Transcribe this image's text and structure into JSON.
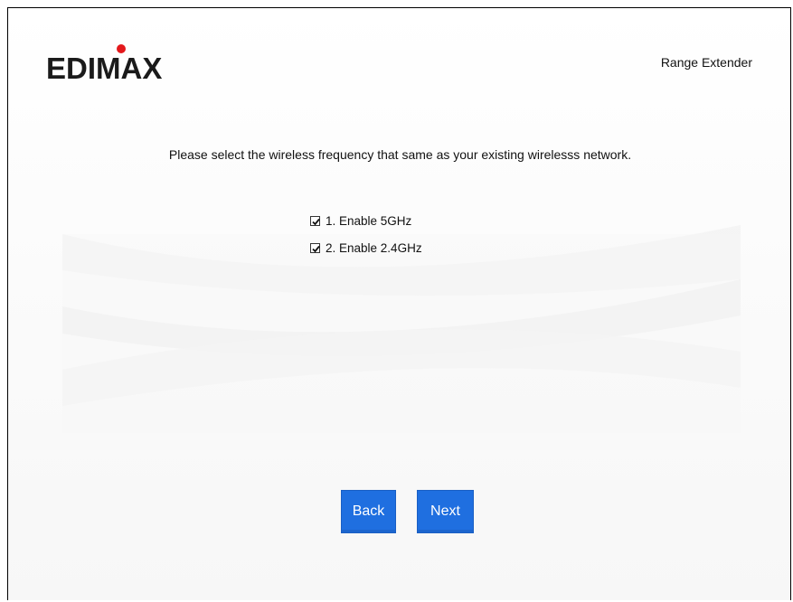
{
  "header": {
    "logo_text": "EDIMAX",
    "product_name": "Range Extender"
  },
  "main": {
    "instruction": "Please select the wireless frequency that same as your existing wirelesss network.",
    "options": [
      {
        "label": "1. Enable 5GHz",
        "checked": true
      },
      {
        "label": "2. Enable 2.4GHz",
        "checked": true
      }
    ]
  },
  "buttons": {
    "back_label": "Back",
    "next_label": "Next"
  },
  "colors": {
    "button_bg": "#1f6fe0",
    "logo_dot": "#e3181b",
    "logo_text": "#1a1a1a"
  }
}
